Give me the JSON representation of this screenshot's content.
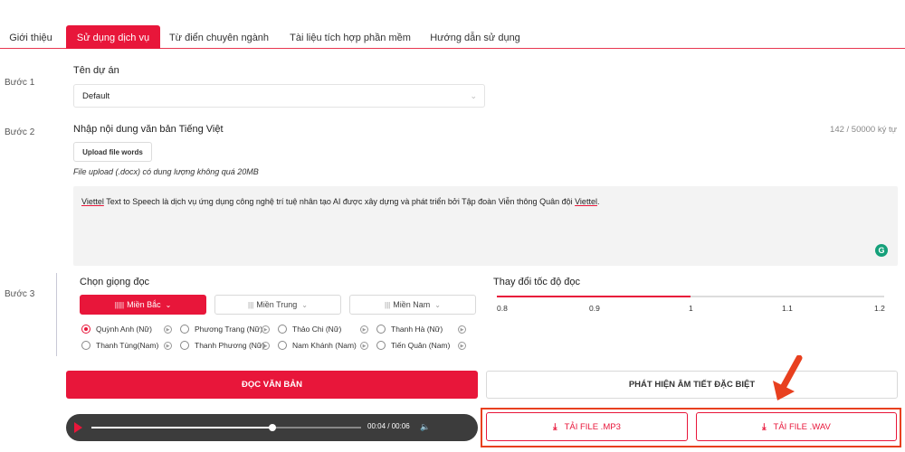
{
  "tabs": [
    {
      "label": "Giới thiệu",
      "active": false
    },
    {
      "label": "Sử dụng dịch vụ",
      "active": true
    },
    {
      "label": "Từ điển chuyên ngành",
      "active": false
    },
    {
      "label": "Tài liệu tích hợp phần mềm",
      "active": false
    },
    {
      "label": "Hướng dẫn sử dụng",
      "active": false
    }
  ],
  "steps": {
    "step1": "Bước 1",
    "step2": "Bước 2",
    "step3": "Bước 3"
  },
  "project": {
    "label": "Tên dự án",
    "value": "Default"
  },
  "content": {
    "label": "Nhập nội dung văn bản Tiếng Việt",
    "counter": "142 / 50000 ký tự",
    "upload_button": "Upload file words",
    "upload_note": "File upload (.docx) có dung lượng không quá 20MB",
    "text_part1": "Viettel",
    "text_part2": " Text to Speech là dịch vụ ứng dụng công nghệ trí tuệ nhân tạo AI được xây dựng và phát triển bởi Tập đoàn Viễn thông Quân đội ",
    "text_part3": "Viettel",
    "text_part4": ".",
    "grammarly_glyph": "G"
  },
  "voice": {
    "label": "Chọn giọng đọc",
    "regions": [
      {
        "label": "Miền Bắc",
        "active": true
      },
      {
        "label": "Miền Trung",
        "active": false
      },
      {
        "label": "Miền Nam",
        "active": false
      }
    ],
    "voices": [
      {
        "name": "Quỳnh Anh (Nữ)",
        "selected": true
      },
      {
        "name": "Phương Trang (Nữ)",
        "selected": false
      },
      {
        "name": "Thảo Chi (Nữ)",
        "selected": false
      },
      {
        "name": "Thanh Hà (Nữ)",
        "selected": false
      },
      {
        "name": "Thanh Tùng(Nam)",
        "selected": false
      },
      {
        "name": "Thanh Phương (Nữ)",
        "selected": false
      },
      {
        "name": "Nam Khánh (Nam)",
        "selected": false
      },
      {
        "name": "Tiến Quân (Nam)",
        "selected": false
      }
    ]
  },
  "speed": {
    "label": "Thay đổi tốc độ đọc",
    "ticks": [
      "0.8",
      "0.9",
      "1",
      "1.1",
      "1.2"
    ],
    "value": 1
  },
  "actions": {
    "read_button": "ĐỌC VĂN BẢN",
    "detect_button": "PHÁT HIỆN ÂM TIẾT ĐẶC BIỆT",
    "download_mp3": "TẢI FILE .MP3",
    "download_wav": "TẢI FILE .WAV"
  },
  "player": {
    "current_time": "00:04",
    "separator": "/",
    "duration": "00:06",
    "progress": 0.67
  },
  "colors": {
    "accent": "#e8163a",
    "highlight_box": "#e8401f"
  }
}
